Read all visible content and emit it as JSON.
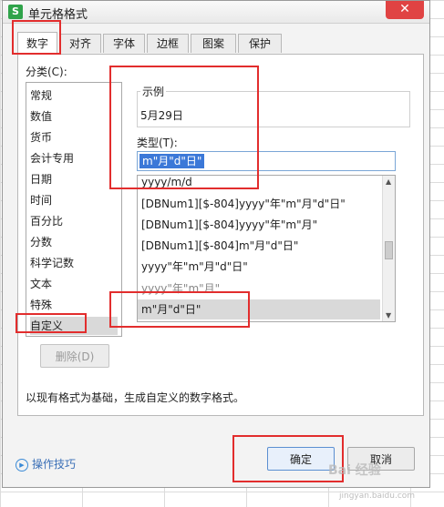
{
  "window": {
    "title": "单元格格式",
    "app_icon": "S",
    "close_glyph": "✕"
  },
  "tabs": [
    {
      "label": "数字",
      "active": true
    },
    {
      "label": "对齐"
    },
    {
      "label": "字体"
    },
    {
      "label": "边框"
    },
    {
      "label": "图案"
    },
    {
      "label": "保护"
    }
  ],
  "category": {
    "label": "分类(C):",
    "items": [
      "常规",
      "数值",
      "货币",
      "会计专用",
      "日期",
      "时间",
      "百分比",
      "分数",
      "科学记数",
      "文本",
      "特殊",
      "自定义"
    ],
    "selected": "自定义"
  },
  "sample": {
    "label": "示例",
    "value": "5月29日"
  },
  "type": {
    "label": "类型(T):",
    "input_value": "m\"月\"d\"日\"",
    "items": [
      "yyyy/m/d",
      "[DBNum1][$-804]yyyy\"年\"m\"月\"d\"日\"",
      "[DBNum1][$-804]yyyy\"年\"m\"月\"",
      "[DBNum1][$-804]m\"月\"d\"日\"",
      "yyyy\"年\"m\"月\"d\"日\"",
      "yyyy\"年\"m\"月\"",
      "m\"月\"d\"日\""
    ],
    "selected": "m\"月\"d\"日\""
  },
  "buttons": {
    "delete": "删除(D)",
    "ok": "确定",
    "cancel": "取消"
  },
  "description": "以现有格式为基础，生成自定义的数字格式。",
  "tips": {
    "label": "操作技巧"
  },
  "watermark": {
    "text": "Bai 经验",
    "sub": "jingyan.baidu.com"
  }
}
